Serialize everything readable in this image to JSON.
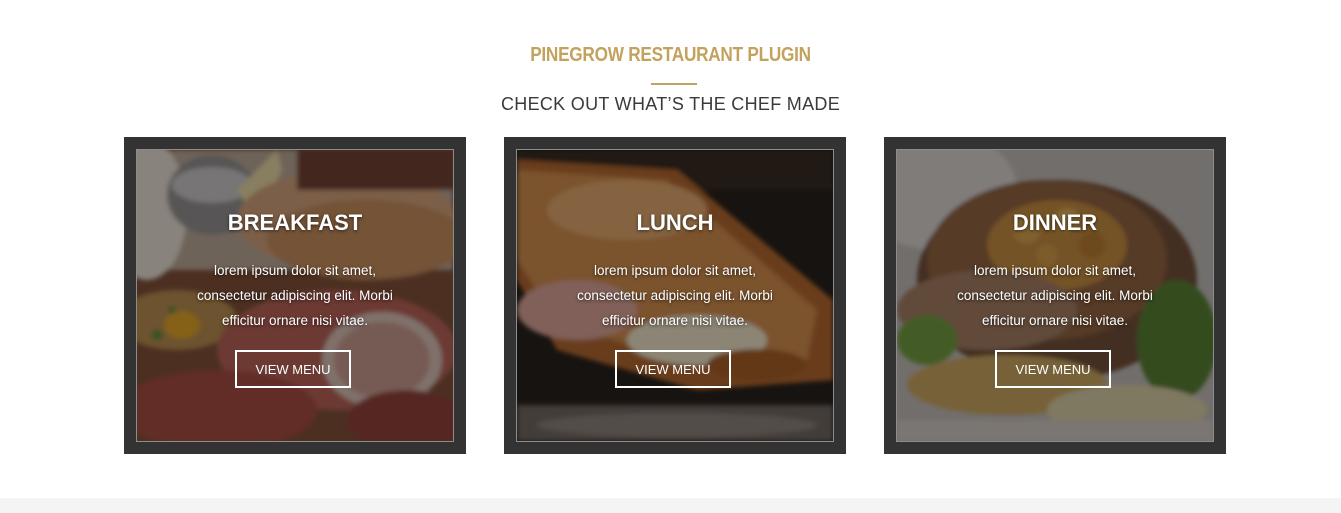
{
  "header": {
    "eyebrow": "PINEGROW RESTAURANT PLUGIN",
    "subtitle": "CHECK OUT WHAT’S THE CHEF MADE"
  },
  "colors": {
    "accent": "#c2a25d",
    "card_frame": "#333333",
    "subtitle": "#3a3a3a"
  },
  "cards": [
    {
      "title": "BREAKFAST",
      "text": "lorem ipsum dolor sit amet, consectetur adipiscing elit. Morbi efficitur ornare nisi vitae.",
      "button": "VIEW MENU",
      "image": "breakfast-photo"
    },
    {
      "title": "LUNCH",
      "text": "lorem ipsum dolor sit amet, consectetur adipiscing elit. Morbi efficitur ornare nisi vitae.",
      "button": "VIEW MENU",
      "image": "lunch-photo"
    },
    {
      "title": "DINNER",
      "text": "lorem ipsum dolor sit amet, consectetur adipiscing elit. Morbi efficitur ornare nisi vitae.",
      "button": "VIEW MENU",
      "image": "dinner-photo"
    }
  ]
}
